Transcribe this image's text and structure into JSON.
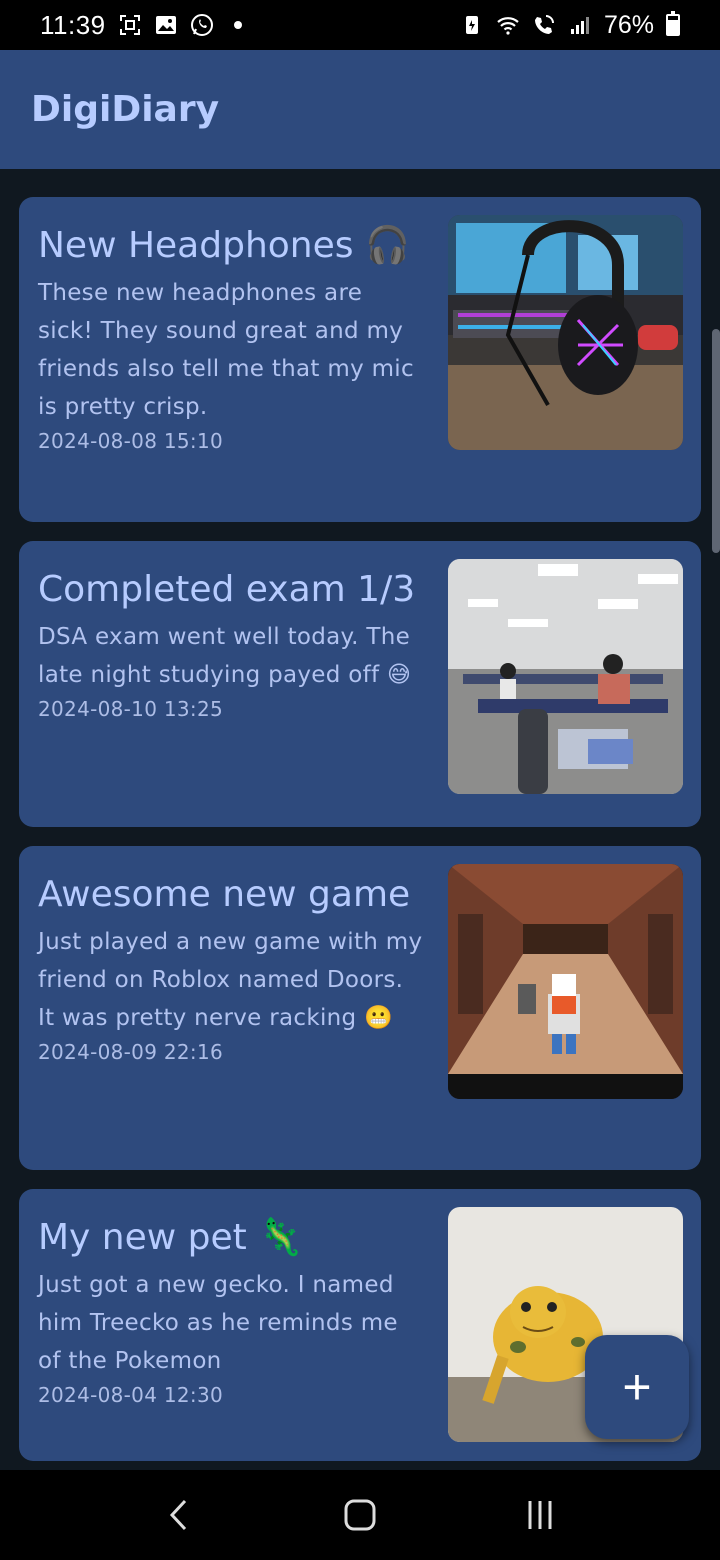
{
  "status_bar": {
    "time": "11:39",
    "battery": "76%",
    "battery_level": 0.76,
    "left_icons": [
      "screenshot-icon",
      "gallery-icon",
      "whatsapp-icon",
      "dot-icon"
    ],
    "right_icons": [
      "lock-battery-icon",
      "wifi-icon",
      "wifi-call-icon",
      "signal-icon"
    ]
  },
  "app": {
    "title": "DigiDiary"
  },
  "entries": [
    {
      "title": "New Headphones 🎧",
      "body": "These new headphones are sick! They sound great and my friends also tell me that my mic is pretty crisp.",
      "date": "2024-08-08 15:10"
    },
    {
      "title": "Completed exam 1/3",
      "body": "DSA exam went well today. The late night studying payed off 😅",
      "date": "2024-08-10 13:25"
    },
    {
      "title": "Awesome new game",
      "body": "Just played a new game with my friend on Roblox named Doors. It was pretty nerve racking 😬",
      "date": "2024-08-09 22:16"
    },
    {
      "title": "My new pet 🦎",
      "body": "Just got a new gecko. I named him Treecko as he reminds me of the Pokemon",
      "date": "2024-08-04 12:30"
    }
  ],
  "fab": {
    "label": "+"
  },
  "nav": {
    "back": "back-icon",
    "home": "home-icon",
    "recents": "recents-icon"
  },
  "colors": {
    "app_bar": "#2e4a7d",
    "card": "#2e4a7d",
    "background": "#101820",
    "title_text": "#b7ccff"
  }
}
